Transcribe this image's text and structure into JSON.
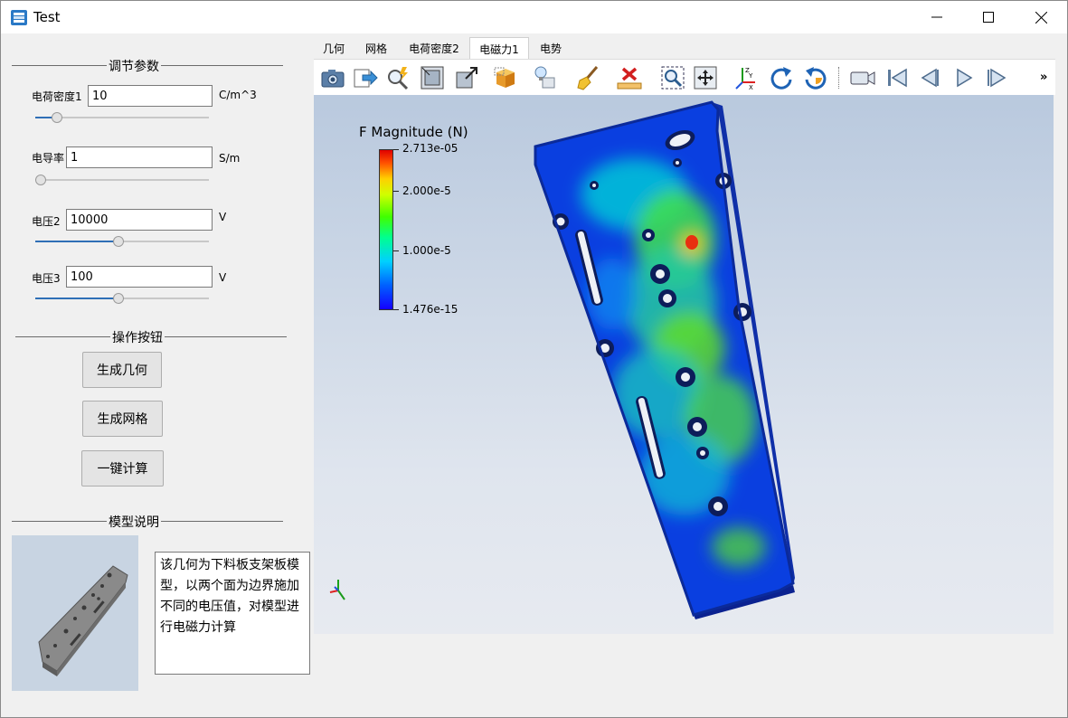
{
  "window": {
    "title": "Test",
    "controls": [
      "minimize-icon",
      "maximize-icon",
      "close-icon"
    ]
  },
  "params": {
    "section_title": "调节参数",
    "items": [
      {
        "label": "电荷密度1",
        "value": "10",
        "unit": "C/m^3",
        "slider_fraction": 0.1
      },
      {
        "label": "电导率",
        "value": "1",
        "unit": "S/m",
        "slider_fraction": 0.0
      },
      {
        "label": "电压2",
        "value": "10000",
        "unit": "V",
        "slider_fraction": 0.48
      },
      {
        "label": "电压3",
        "value": "100",
        "unit": "V",
        "slider_fraction": 0.48
      }
    ]
  },
  "actions": {
    "section_title": "操作按钮",
    "generate_geometry": "生成几何",
    "generate_mesh": "生成网格",
    "compute": "一键计算"
  },
  "model": {
    "section_title": "模型说明",
    "description": "该几何为下料板支架板模型，以两个面为边界施加不同的电压值，对模型进行电磁力计算"
  },
  "tabs": [
    {
      "label": "几何",
      "active": false
    },
    {
      "label": "网格",
      "active": false
    },
    {
      "label": "电荷密度2",
      "active": false
    },
    {
      "label": "电磁力1",
      "active": true
    },
    {
      "label": "电势",
      "active": false
    }
  ],
  "toolbar": {
    "icons": [
      "camera-icon",
      "export-icon",
      "probe-icon",
      "fit-view-icon",
      "zoom-extents-icon",
      "view-box-icon",
      "light-icon",
      "clear-icon",
      "delete-icon",
      "zoom-box-icon",
      "pan-icon",
      "axis-orientation-icon",
      "rotate-cw-icon",
      "rotate-ccw-icon",
      "video-icon",
      "first-frame-icon",
      "previous-frame-icon",
      "play-icon",
      "next-frame-icon"
    ],
    "more": "»"
  },
  "viewport": {
    "legend_title": "F Magnitude (N)",
    "legend_max": "2.713e-05",
    "legend_ticks": [
      "2.000e-5",
      "1.000e-5"
    ],
    "legend_min": "1.476e-15"
  }
}
